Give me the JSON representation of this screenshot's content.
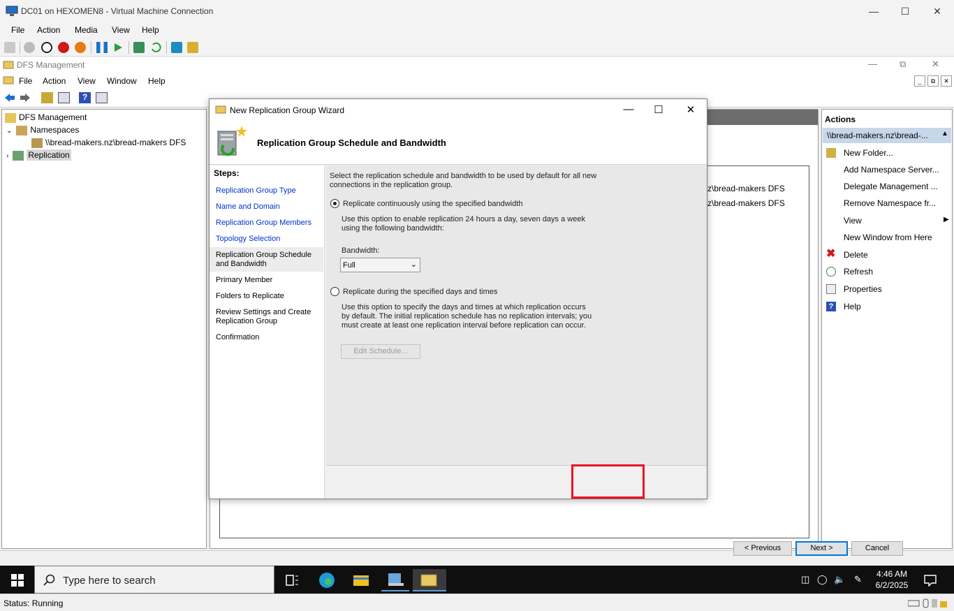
{
  "vm_window": {
    "title": "DC01 on HEXOMEN8 - Virtual Machine Connection",
    "menu": [
      "File",
      "Action",
      "Media",
      "View",
      "Help"
    ],
    "status": "Status: Running"
  },
  "dfs_window": {
    "title": "DFS Management",
    "menu": [
      "File",
      "Action",
      "View",
      "Window",
      "Help"
    ]
  },
  "tree": {
    "root": "DFS Management",
    "namespaces": "Namespaces",
    "namespace_item": "\\\\bread-makers.nz\\bread-makers DFS",
    "replication": "Replication"
  },
  "center": {
    "rows": [
      "z\\bread-makers DFS",
      "z\\bread-makers DFS"
    ]
  },
  "actions": {
    "header": "Actions",
    "subheader": "\\\\bread-makers.nz\\bread-...",
    "items": [
      "New Folder...",
      "Add Namespace Server...",
      "Delegate Management ...",
      "Remove Namespace fr...",
      "View",
      "New Window from Here",
      "Delete",
      "Refresh",
      "Properties",
      "Help"
    ]
  },
  "wizard": {
    "title": "New Replication Group Wizard",
    "heading": "Replication Group Schedule and Bandwidth",
    "steps_header": "Steps:",
    "steps": [
      "Replication Group Type",
      "Name and Domain",
      "Replication Group Members",
      "Topology Selection",
      "Replication Group Schedule and Bandwidth",
      "Primary Member",
      "Folders to Replicate",
      "Review Settings and Create Replication Group",
      "Confirmation"
    ],
    "intro": "Select the replication schedule and bandwidth to be used by default for all new connections in the replication group.",
    "option1_label": "Replicate continuously using the specified bandwidth",
    "option1_desc": "Use this option to enable replication 24 hours a day, seven days a week using the following bandwidth:",
    "bandwidth_label": "Bandwidth:",
    "bandwidth_value": "Full",
    "option2_label": "Replicate during the specified days and times",
    "option2_desc": "Use this option to specify the days and times at which replication occurs by default. The initial replication schedule has no replication intervals; you must create at least one replication interval before replication can occur.",
    "edit_schedule": "Edit Schedule...",
    "previous": "< Previous",
    "next": "Next >",
    "cancel": "Cancel",
    "selected_option": 1
  },
  "taskbar": {
    "search_placeholder": "Type here to search",
    "time": "4:46 AM",
    "date": "6/2/2025"
  }
}
